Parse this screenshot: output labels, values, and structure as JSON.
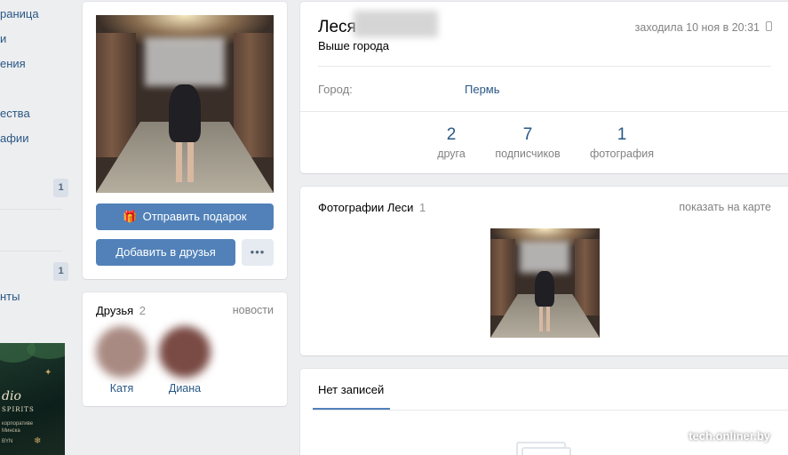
{
  "left_nav": {
    "items": [
      {
        "label": "раница"
      },
      {
        "label": "и"
      },
      {
        "label": "ения"
      },
      {
        "label": "ества"
      },
      {
        "label": "афии"
      },
      {
        "label": "нты"
      }
    ],
    "badges": [
      "1",
      "1"
    ],
    "ad": {
      "title": "dio",
      "subtitle": "SPIRITS",
      "line1": "корпоративе",
      "line2": "Минска",
      "price": "BYN"
    }
  },
  "profile": {
    "actions": {
      "send_gift": "Отправить подарок",
      "add_friend": "Добавить в друзья",
      "more": "•••"
    },
    "friends": {
      "title": "Друзья",
      "count": "2",
      "news_link": "новости",
      "list": [
        {
          "name": "Катя",
          "color": "#a98a82"
        },
        {
          "name": "Диана",
          "color": "#7a4a44"
        }
      ]
    },
    "info": {
      "name": "Леся",
      "last_seen": "заходила 10 ноя в 20:31",
      "status": "Выше города",
      "city_label": "Город:",
      "city_value": "Пермь"
    },
    "counters": [
      {
        "value": "2",
        "label": "друга"
      },
      {
        "value": "7",
        "label": "подписчиков"
      },
      {
        "value": "1",
        "label": "фотография"
      }
    ],
    "photos": {
      "title": "Фотографии Леси",
      "count": "1",
      "map_link": "показать на карте"
    },
    "wall": {
      "tab_label": "Нет записей"
    }
  },
  "watermark": "tech.onliner.by",
  "colors": {
    "accent": "#5181b8",
    "link": "#2a5885",
    "background": "#edeef0"
  }
}
